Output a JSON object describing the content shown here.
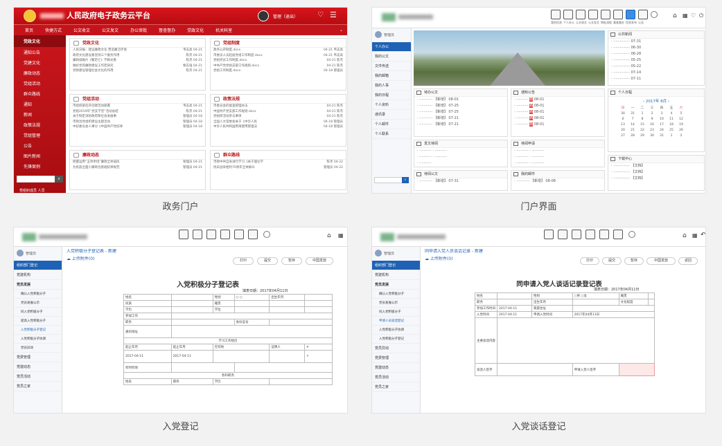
{
  "captions": [
    "政务门户",
    "门户界面",
    "入党登记",
    "入党谈话登记"
  ],
  "card1": {
    "app_title": "人民政府电子政务云平台",
    "user_text": "管理（退出）",
    "nav": [
      "首页",
      "快捷方式",
      "公文收文",
      "公文发文",
      "办公审批",
      "督查督办",
      "党政文化",
      "机关科室"
    ],
    "sidebar_title": "党政文化",
    "sidebar": [
      "通知公告",
      "党建文化",
      "廉政动态",
      "党组活动",
      "群众路线",
      "通知",
      "新闻",
      "政策法规",
      "党组管理",
      "公告",
      "图片新闻",
      "先锋案例"
    ],
    "sidebar_footer": "党组织成员 人员",
    "panels": [
      {
        "title": "党政文化",
        "rows": [
          [
            "人民日报：建设廉政文化 营造廉洁环境",
            "韦志高 04-21"
          ],
          [
            "政府文化建设要坚持三个服务作用",
            "陈杰 04-21"
          ],
          [
            "廉政诚勉片《警足亡》学教光看",
            "陈杰 04-21"
          ],
          [
            "做好党风廉政建设工作若研究",
            "黎志强 04-21"
          ],
          [
            "党政建设管理社会文化的作用",
            "陈杰 04-21"
          ]
        ]
      },
      {
        "title": "党组制度",
        "rows": [
          [
            "政务公开制度.docx",
            "04-21 韦志高"
          ],
          [
            "市委员人员起居党组工作制度.docx",
            "04-21 韦志高"
          ],
          [
            "党组党员工作制度.docx",
            "04-21 陈杰"
          ],
          [
            "中共产党党组支部工作规则.docx",
            "04-21 陈杰"
          ],
          [
            "党组工作制度.docx",
            "04-18 管理员"
          ]
        ]
      },
      {
        "title": "党组活动",
        "rows": [
          [
            "市组织部召开创建活动部署",
            "韦志高 04-21"
          ],
          [
            "党组2019年“党支学堂”活动总结",
            "陈杰 04-21"
          ],
          [
            "关于制定消防政府和社会发展事",
            "管理员 04-18"
          ],
          [
            "市政治党组织建设主题活动",
            "管理员 04-18"
          ],
          [
            "中纪委员会人事讨《中国共产党纪律",
            "管理员 04-18"
          ]
        ]
      },
      {
        "title": "政策法规",
        "rows": [
          [
            "市委员会的督查管理办法",
            "04-21 陈杰"
          ],
          [
            "中国共产党支部工作规则.docx",
            "04-21 陈杰"
          ],
          [
            "党组织活动参与事项",
            "04-21 陈杰"
          ],
          [
            "全国人大常委会关于《中华人民",
            "04-18 管理员"
          ],
          [
            "中华人民共和国用海使用管理法",
            "04-18 管理员"
          ]
        ]
      },
      {
        "title": "廉政动态",
        "rows": [
          [
            "把握运用“五项举措”廉政全体居民",
            "管理员 04-21"
          ],
          [
            "为民族全面小康政治基础纪律规范",
            "管理员 04-21"
          ]
        ]
      },
      {
        "title": "群众路线",
        "rows": [
          [
            "市政中共自身进行学习《关于理论学",
            "陈杰 04-22"
          ],
          [
            "抗日战争胜利70周年全体群众",
            "管理员 04-22"
          ]
        ]
      }
    ]
  },
  "card2": {
    "toolbar": [
      "我的信息",
      "个人办公",
      "公文收文",
      "公文发文",
      "审批流程",
      "督查督办",
      "信息发布",
      "公告"
    ],
    "sidebar": [
      "管理员",
      "个人办公",
      "我的公文",
      "文件传送",
      "我的邮箱",
      "我的人事",
      "我的日程",
      "个人资料",
      "通讯录",
      "个人邮件",
      "个人联系"
    ],
    "panels": [
      "公共新闻",
      "待办公文",
      "通知公告",
      "个人日程",
      "发文待阅",
      "待阅申请",
      "待阅公文",
      "我的邮件",
      "下载中心"
    ],
    "calendar_title": "2017年 8月",
    "weekdays": [
      "日",
      "一",
      "二",
      "三",
      "四",
      "五",
      "六"
    ],
    "days": [
      [
        "30",
        "31",
        "1",
        "2",
        "3",
        "4",
        "5"
      ],
      [
        "6",
        "7",
        "8",
        "9",
        "10",
        "11",
        "12"
      ],
      [
        "13",
        "14",
        "15",
        "16",
        "17",
        "18",
        "19"
      ],
      [
        "20",
        "21",
        "22",
        "23",
        "24",
        "25",
        "26"
      ],
      [
        "27",
        "28",
        "29",
        "30",
        "31",
        "1",
        "2"
      ]
    ]
  },
  "card3": {
    "breadcrumb": "入党积极分子登记表 - 新建",
    "submenu": "上传附件(0)",
    "buttons": [
      "打印",
      "提交",
      "暂存",
      "中国发放"
    ],
    "title": "入党积极分子登记表",
    "date": "填表日期：2017年04月11日",
    "sidebar": [
      "管理员",
      "组织部门登记",
      "党建机构",
      "党员发展",
      "确认入党积极分子",
      "党员发展公示",
      "同入党积极分子",
      "提高入党积极分子",
      "入党积极分子登记",
      "入党积极分子协调",
      "党员异动",
      "党费管理",
      "党建动态",
      "党员活动",
      "党员之家"
    ],
    "labels": [
      "姓名",
      "性别",
      "出生年月",
      "民族",
      "籍贯",
      "学历",
      "学位",
      "参加工作",
      "职务",
      "何时何地",
      "身份证号",
      "通讯地址",
      "各科职务",
      "学习工作经历",
      "起止年月",
      "在何地",
      "证明人",
      "2017-04-11"
    ]
  },
  "card4": {
    "breadcrumb": "同申请入党人员谈话记录 - 新建",
    "submenu": "上传附件(0)",
    "buttons": [
      "打印",
      "提交",
      "暂存",
      "中国发放",
      "返回"
    ],
    "title": "同申请入党人谈话记录登记表",
    "date": "填表日期：2017年04月11日",
    "sidebar": [
      "管理员",
      "组织部门登记",
      "党建机构",
      "党员发展",
      "确认入党积极分子",
      "党员发展公示",
      "同入党积极分子",
      "申请人员谈话登记",
      "入党积极分子协调",
      "入党积极分子登记",
      "党员异动",
      "党费管理",
      "党建动态",
      "党员活动",
      "党员之家"
    ],
    "labels": [
      "姓名",
      "性别",
      "男",
      "女",
      "籍贯",
      "职务",
      "出生年月",
      "文化程度",
      "参加工作时间",
      "2017-04-11",
      "家庭住址",
      "入党时间",
      "申请入党时间",
      "2017年04月11日",
      "主要谈话内容",
      "谈话人签字",
      "申请入党人签字"
    ]
  },
  "colors": {
    "red": "#c4141b",
    "blue": "#1f62b5"
  }
}
